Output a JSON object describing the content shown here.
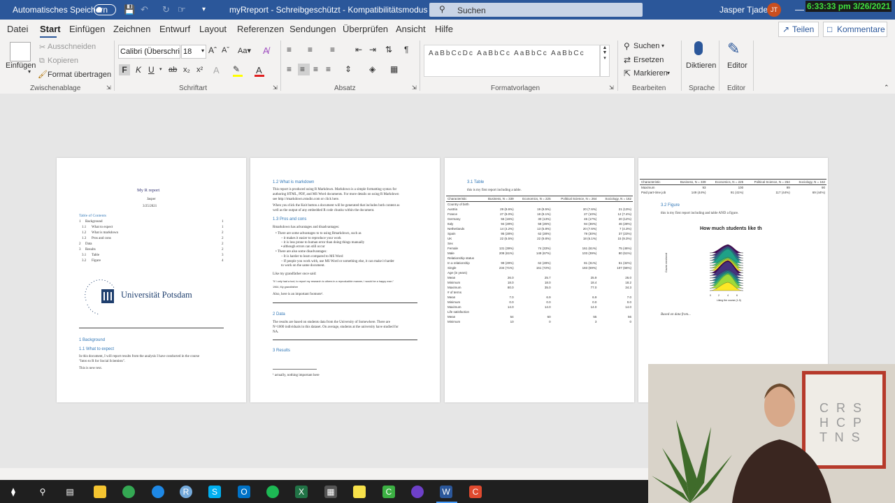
{
  "titlebar": {
    "autosave_label": "Automatisches Speichern",
    "document_title": "myRreport  -  Schreibgeschützt  -  Kompatibilitätsmodus  ⌄",
    "search_placeholder": "Suchen",
    "user_name": "Jasper Tjaden",
    "user_initials": "JT",
    "clock": "6:33:33 pm 3/26/2021"
  },
  "menu": {
    "tabs": [
      "Datei",
      "Start",
      "Einfügen",
      "Zeichnen",
      "Entwurf",
      "Layout",
      "Referenzen",
      "Sendungen",
      "Überprüfen",
      "Ansicht",
      "Hilfe"
    ],
    "share_label": "Teilen",
    "comments_label": "Kommentare"
  },
  "ribbon": {
    "paste_label": "Einfügen",
    "cut_label": "Ausschneiden",
    "copy_label": "Kopieren",
    "format_painter_label": "Format übertragen",
    "clipboard_group": "Zwischenablage",
    "font_name": "Calibri (Überschri",
    "font_size": "18",
    "font_group": "Schriftart",
    "paragraph_group": "Absatz",
    "styles_group": "Formatvorlagen",
    "find_label": "Suchen",
    "replace_label": "Ersetzen",
    "select_label": "Markieren",
    "editing_group": "Bearbeiten",
    "dictate_label": "Diktieren",
    "voice_group": "Sprache",
    "editor_label": "Editor",
    "editor_group": "Editor"
  },
  "page1": {
    "title": "My R report",
    "author": "Jasper",
    "date": "3/25/2021",
    "toc_heading": "Table of Contents",
    "toc": [
      {
        "num": "1",
        "text": "Background",
        "page": "1"
      },
      {
        "num": "1.1",
        "text": "What to expect",
        "page": "1"
      },
      {
        "num": "1.2",
        "text": "What is markdown",
        "page": "2"
      },
      {
        "num": "1.3",
        "text": "Pros and cons",
        "page": "2"
      },
      {
        "num": "2",
        "text": "Data",
        "page": "2"
      },
      {
        "num": "3",
        "text": "Results",
        "page": "2"
      },
      {
        "num": "3.1",
        "text": "Table",
        "page": "3"
      },
      {
        "num": "3.2",
        "text": "Figure",
        "page": "4"
      }
    ],
    "logo_text": "Universität Potsdam",
    "logo_arc": "Universität Potsdam",
    "h1": "1      Background",
    "h2": "1.1    What to expect",
    "body1": "In this document, I will report results from the analysis I have conducted in the course",
    "body2": "\"Intro to R for Social Scientists\".",
    "body3": "This is new text."
  },
  "page2": {
    "h12": "1.2    What is markdown",
    "p1": "This report is produced using R Markdown. Markdown is a simple formatting syntax for",
    "p2": "authoring HTML, PDF, and MS Word documents. For more details on using R Markdown",
    "p3": "see http://rmarkdown.rstudio.com or click here.",
    "p4": "When you click the Knit button a document will be generated that includes both content as",
    "p5": "well as the output of any embedded R code chunks within the document.",
    "h13": "1.3    Pros and cons",
    "p6": "Rmarkdown has advantages and disadvantages:",
    "bullets": [
      "There are some advantages to to using Rmarkdown, such as",
      "   –  it makes it easier to reproduce your work",
      "   –  it is less prone to human error than doing things manually",
      "        ▪  although errors can still occur",
      "There are also some disadvantages:",
      "   –  It is harder to learn compared to MS Word",
      "   –  If people you work with, use MS Word or something else, it can make it harder",
      "      to work on the same document."
    ],
    "p7": "Like my grandfather once said:",
    "quote": "\"If I only had a tool, to report my research to others in a reproducible manner, I would be a happy man.\"",
    "quote_src": "1964, My grandfather",
    "p8": "Also, here is an important footnote¹.",
    "h2": "2      Data",
    "p9": "The results are based on students data from the University of Somewhere. There are",
    "p10": "N=1000 individuals in this dataset. On average, students at the university have studied for",
    "p11": "NA.",
    "h3": "3      Results",
    "footnote": "¹ actually, nothing important here"
  },
  "page3": {
    "h31": "3.1    Table",
    "intro": "this is my first report including a table.",
    "headers": [
      "Characteristic",
      "Business, N = 339",
      "Economics, N = 225",
      "Political Science, N = 264",
      "Sociology, N = 162"
    ],
    "rows": [
      [
        "Country of birth",
        "",
        "",
        "",
        ""
      ],
      [
        "  Austria",
        "29 (8.6%)",
        "19 (8.5%)",
        "20 (7.6%)",
        "21 (13%)"
      ],
      [
        "  France",
        "27 (8.0%)",
        "18 (8.1%)",
        "27 (10%)",
        "12 (7.4%)"
      ],
      [
        "  Germany",
        "55 (16%)",
        "30 (13%)",
        "46 (17%)",
        "20 (12%)"
      ],
      [
        "  Italy",
        "94 (28%)",
        "58 (26%)",
        "94 (36%)",
        "46 (28%)"
      ],
      [
        "  Netherlands",
        "14 (4.2%)",
        "13 (5.8%)",
        "20 (7.6%)",
        "7 (4.3%)"
      ],
      [
        "  Spain",
        "95 (28%)",
        "62 (28%)",
        "79 (30%)",
        "37 (23%)"
      ],
      [
        "  UK",
        "22 (6.5%)",
        "22 (9.8%)",
        "18 (6.1%)",
        "15 (9.3%)"
      ],
      [
        "Sex",
        "",
        "",
        "",
        ""
      ],
      [
        "  Female",
        "131 (39%)",
        "74 (33%)",
        "161 (61%)",
        "75 (46%)"
      ],
      [
        "  Male",
        "208 (61%)",
        "149 (67%)",
        "103 (39%)",
        "80 (51%)"
      ],
      [
        "Relationship status",
        "",
        "",
        "",
        ""
      ],
      [
        "  In a relationship",
        "99 (29%)",
        "62 (28%)",
        "81 (31%)",
        "51 (32%)"
      ],
      [
        "  Single",
        "234 (71%)",
        "161 (72%)",
        "183 (69%)",
        "107 (66%)"
      ],
      [
        "Age (in years)",
        "",
        "",
        "",
        ""
      ],
      [
        "  Mean",
        "26.0",
        "25.7",
        "25.9",
        "26.0"
      ],
      [
        "  Minimum",
        "18.0",
        "18.0",
        "18.4",
        "18.2"
      ],
      [
        "  Maximum",
        "80.0",
        "35.0",
        "77.0",
        "34.3"
      ],
      [
        "# of terms",
        "",
        "",
        "",
        ""
      ],
      [
        "  Mean",
        "7.0",
        "6.9",
        "6.9",
        "7.0"
      ],
      [
        "  Minimum",
        "0.0",
        "0.0",
        "0.0",
        "0.0"
      ],
      [
        "  Maximum",
        "14.0",
        "14.0",
        "14.0",
        "14.0"
      ],
      [
        "Life satisfaction",
        "",
        "",
        "",
        ""
      ],
      [
        "  Mean",
        "54",
        "60",
        "55",
        "56"
      ],
      [
        "  Minimum",
        "10",
        "0",
        "3",
        "0"
      ]
    ]
  },
  "page4": {
    "headers": [
      "Characteristic",
      "Business, N = 339",
      "Economics, N = 225",
      "Political Science, N = 264",
      "Sociology, N = 162"
    ],
    "rows": [
      [
        "  Maximum",
        "93",
        "100",
        "99",
        "90"
      ],
      [
        "Paid part-time job",
        "149 (44%)",
        "91 (41%)",
        "117 (44%)",
        "69 (44%)"
      ]
    ],
    "h32": "3.2    Figure",
    "intro": "this is my first report including and table AND a figure.",
    "fig_title": "How much students like th",
    "fig_ylabel": "Course enrolment",
    "fig_xlabel": "Liking the course (1-9)",
    "fig_xticks": [
      "0",
      "2",
      "4",
      "6"
    ],
    "caption": "Based on data from..."
  },
  "webcam": {
    "sign_lines": [
      "C R S",
      "H C P",
      "T N S"
    ]
  },
  "colors": {
    "word_blue": "#2b579a",
    "heading_blue": "#2e75b6",
    "clock_green": "#3ee03e"
  },
  "taskbar": {
    "icons": [
      "windows-start",
      "search",
      "task-view",
      "file-explorer",
      "chrome",
      "edge",
      "rstudio",
      "skype",
      "outlook",
      "spotify",
      "excel",
      "calculator",
      "sticky-notes",
      "camtasia",
      "github-desktop",
      "word",
      "snagit"
    ]
  }
}
